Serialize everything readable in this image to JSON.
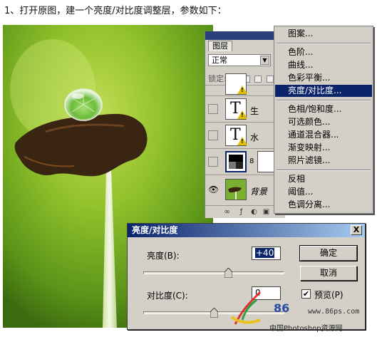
{
  "caption": "1、打开原图，建一个亮度/对比度调整层，参数如下：",
  "layers_panel": {
    "tab": "图层",
    "blend_mode": "正常",
    "lock_label": "锁定:",
    "layers": [
      {
        "name": "",
        "type": "text"
      },
      {
        "name": "生",
        "type": "text"
      },
      {
        "name": "水",
        "type": "text"
      },
      {
        "name": "",
        "type": "adjustment"
      },
      {
        "name": "背景",
        "type": "image"
      }
    ]
  },
  "menu": {
    "items": [
      {
        "label": "图案..."
      },
      {
        "label": "色阶..."
      },
      {
        "label": "曲线..."
      },
      {
        "label": "色彩平衡..."
      },
      {
        "label": "亮度/对比度...",
        "selected": true
      },
      {
        "label": "色相/饱和度..."
      },
      {
        "label": "可选颜色..."
      },
      {
        "label": "通道混合器..."
      },
      {
        "label": "渐变映射..."
      },
      {
        "label": "照片滤镜..."
      },
      {
        "label": "反相"
      },
      {
        "label": "阈值..."
      },
      {
        "label": "色调分离..."
      }
    ]
  },
  "dialog": {
    "title": "亮度/对比度",
    "close": "X",
    "brightness_label": "亮度(B):",
    "brightness_value": "+40",
    "brightness_slider": 0.6,
    "contrast_label": "对比度(C):",
    "contrast_value": "0",
    "contrast_slider": 0.5,
    "ok": "确定",
    "cancel": "取消",
    "preview_label": "预览(P)",
    "preview_checked": true
  },
  "watermark": {
    "url": "www.86ps.com",
    "brand": "86",
    "site": "中国Photoshop资源网"
  },
  "colors": {
    "menu_highlight": "#0a246a",
    "dialog_title_start": "#0a246a",
    "panel_bg": "#d4d0c8"
  }
}
